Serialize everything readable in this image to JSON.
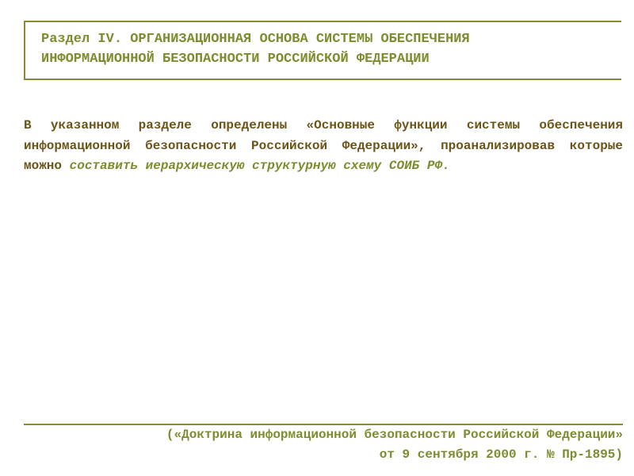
{
  "title": {
    "line1": "Раздел IV. ОРГАНИЗАЦИОННАЯ ОСНОВА СИСТЕМЫ ОБЕСПЕЧЕНИЯ",
    "line2": "ИНФОРМАЦИОННОЙ БЕЗОПАСНОСТИ РОССИЙСКОЙ ФЕДЕРАЦИИ"
  },
  "body": {
    "regular": "В указанном разделе определены «Основные функции системы обеспечения информационной безопасности Российской Федерации», проанализировав которые можно ",
    "italic": "составить иерархическую структурную схему СОИБ РФ."
  },
  "footer": {
    "line1": "(«Доктрина информационной безопасности Российской Федерации»",
    "line2": "от 9 сентября 2000 г. № Пр-1895)"
  }
}
